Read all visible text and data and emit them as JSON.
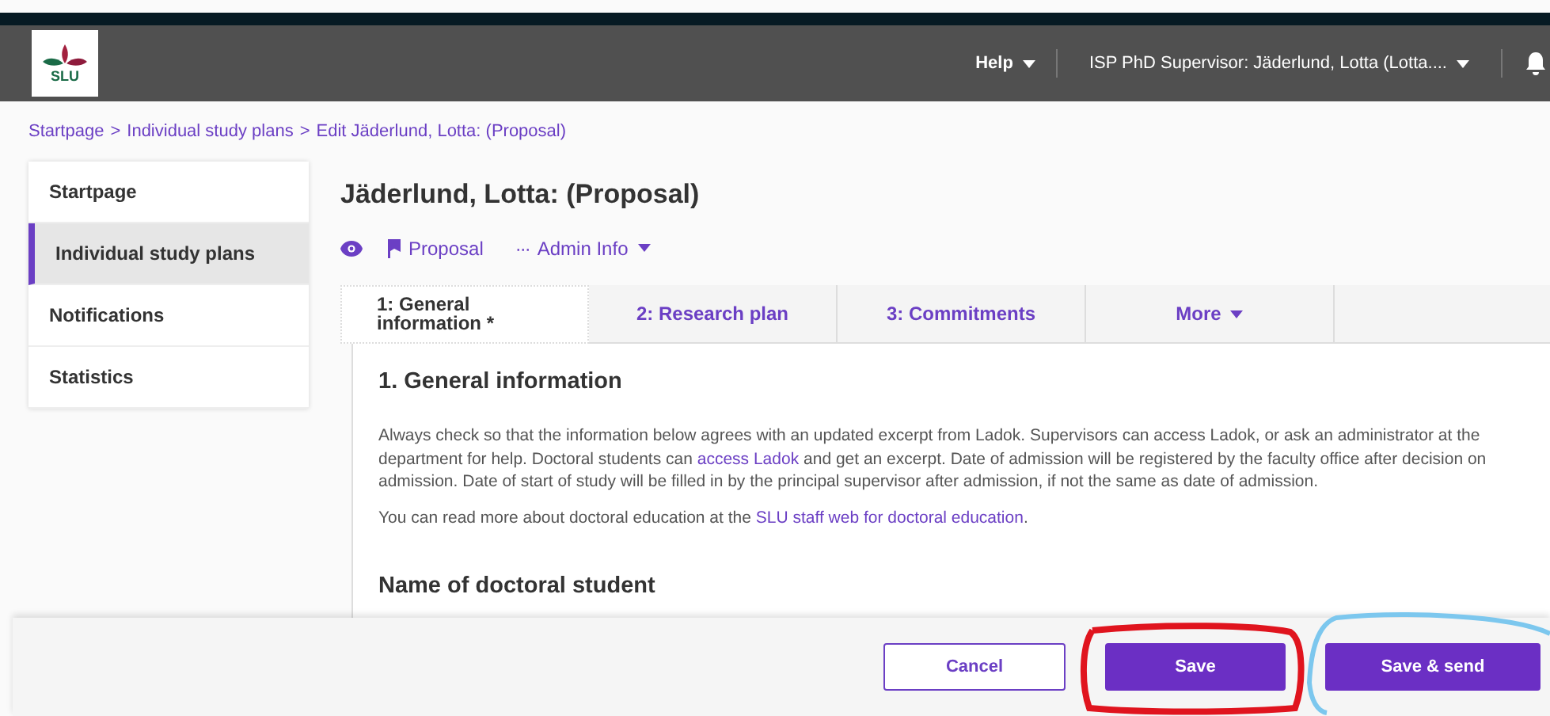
{
  "header": {
    "logo_text": "SLU",
    "help": "Help",
    "user": "ISP PhD Supervisor: Jäderlund, Lotta (Lotta...."
  },
  "breadcrumb": [
    "Startpage",
    "Individual study plans",
    "Edit Jäderlund, Lotta: (Proposal)"
  ],
  "breadcrumb_separator": ">",
  "sidebar": {
    "items": [
      {
        "label": "Startpage",
        "selected": false
      },
      {
        "label": "Individual study plans",
        "selected": true
      },
      {
        "label": "Notifications",
        "selected": false
      },
      {
        "label": "Statistics",
        "selected": false
      }
    ]
  },
  "page_title": "Jäderlund, Lotta: (Proposal)",
  "status_links": [
    {
      "kind": "eye"
    },
    {
      "kind": "flag",
      "label": "Proposal"
    },
    {
      "kind": "menu",
      "icon": "···",
      "label": "Admin Info"
    }
  ],
  "tabs": [
    {
      "label": "1: General information *",
      "selected": true,
      "dropdown": false
    },
    {
      "label": "2: Research plan",
      "selected": false,
      "dropdown": false
    },
    {
      "label": "3: Commitments",
      "selected": false,
      "dropdown": false
    },
    {
      "label": "More",
      "selected": false,
      "dropdown": true
    }
  ],
  "section": {
    "heading": "1. General information",
    "paragraphs": [
      [
        {
          "text": "Always check so that the information below agrees with an updated excerpt from Ladok. Supervisors can access Ladok, or ask an administrator at the department for help. Doctoral students can ",
          "link": false
        },
        {
          "text": "access Ladok",
          "link": true
        },
        {
          "text": " and get an excerpt. Date of admission will be registered by the faculty office after decision on admission. Date of start of study will be filled in by the principal supervisor after admission, if not the same as date of admission.",
          "link": false
        }
      ],
      [
        {
          "text": "You can read more about doctoral education at the ",
          "link": false
        },
        {
          "text": "SLU staff web for doctoral education",
          "link": true
        },
        {
          "text": ".",
          "link": false
        }
      ]
    ]
  },
  "subheading": "Name of doctoral student",
  "footer": {
    "buttons": [
      {
        "label": "Cancel",
        "kind": "outline"
      },
      {
        "label": "Save",
        "kind": "primary"
      },
      {
        "label": "Save & send",
        "kind": "primary"
      }
    ]
  }
}
